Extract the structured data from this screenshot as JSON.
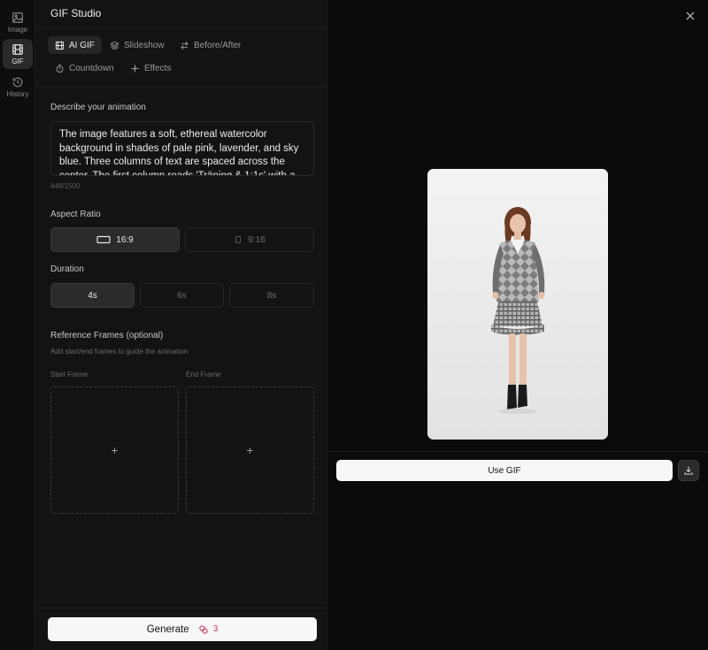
{
  "rail": {
    "items": [
      {
        "label": "Image",
        "icon": "image-icon"
      },
      {
        "label": "GIF",
        "icon": "film-icon"
      },
      {
        "label": "History",
        "icon": "history-icon"
      }
    ]
  },
  "panel": {
    "title": "GIF Studio",
    "tabs": [
      {
        "label": "AI GIF",
        "icon": "film-icon",
        "active": true
      },
      {
        "label": "Slideshow",
        "icon": "layers-icon"
      },
      {
        "label": "Before/After",
        "icon": "swap-icon"
      },
      {
        "label": "Countdown",
        "icon": "timer-icon"
      },
      {
        "label": "Effects",
        "icon": "sparkle-icon"
      }
    ],
    "prompt": {
      "label": "Describe your animation",
      "value": "The image features a soft, ethereal watercolor background in shades of pale pink, lavender, and sky blue. Three columns of text are spaced across the center. The first column reads 'Träning & 1:1s' with a",
      "char_count": "448/1500"
    },
    "aspect_ratio": {
      "label": "Aspect Ratio",
      "options": [
        {
          "label": "16:9",
          "selected": true
        },
        {
          "label": "9:16",
          "selected": false
        }
      ]
    },
    "duration": {
      "label": "Duration",
      "options": [
        {
          "label": "4s",
          "selected": true
        },
        {
          "label": "6s",
          "selected": false
        },
        {
          "label": "8s",
          "selected": false
        }
      ]
    },
    "reference_frames": {
      "label": "Reference Frames (optional)",
      "hint": "Add start/end frames to guide the animation",
      "start_label": "Start Frame",
      "end_label": "End Frame",
      "add_glyph": "+"
    },
    "generate": {
      "label": "Generate",
      "credits": "3",
      "credit_color": "#d23a5a"
    }
  },
  "preview": {
    "use_label": "Use GIF",
    "image_description": "fashion model in grey argyle cardigan and plaid ruffle skirt with black boots on white background"
  }
}
